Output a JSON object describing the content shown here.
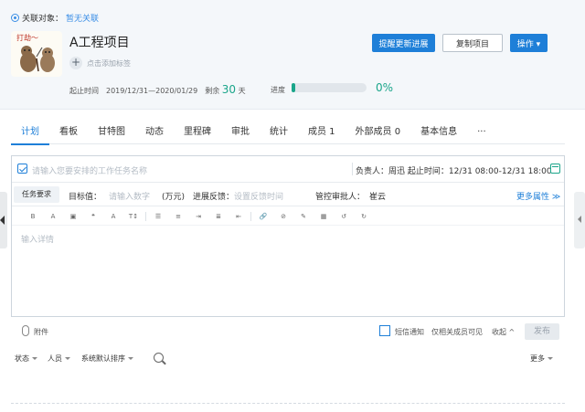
{
  "header": {
    "assoc_label": "关联对象：",
    "assoc_value": "暂无关联",
    "avatar_text": "打劫～",
    "title": "A工程项目",
    "add_tag": "点击添加标签",
    "buttons": {
      "remind": "提醒更新进展",
      "copy": "复制项目",
      "actions": "操作 ▾"
    },
    "meta": {
      "period_label": "起止时间",
      "period_value": "2019/12/31—2020/01/29",
      "remain_label": "剩余",
      "remain_num": "30",
      "remain_unit": "天",
      "progress_label": "进度",
      "progress_value": "0%",
      "progress_fraction": 0
    }
  },
  "tabs": [
    {
      "label": "计划"
    },
    {
      "label": "看板"
    },
    {
      "label": "甘特图"
    },
    {
      "label": "动态"
    },
    {
      "label": "里程碑"
    },
    {
      "label": "审批"
    },
    {
      "label": "统计"
    },
    {
      "label": "成员 1"
    },
    {
      "label": "外部成员 0"
    },
    {
      "label": "基本信息"
    },
    {
      "label": "···"
    }
  ],
  "editor": {
    "task_placeholder": "请输入您要安排的工作任务名称",
    "owner": "负责人：周迅",
    "time": "起止时间：12/31 08:00-12/31 18:00",
    "req_label": "任务要求",
    "target_label": "目标值：",
    "target_placeholder": "请输入数字",
    "target_unit": "(万元)",
    "feedback_label": "进展反馈：",
    "feedback_placeholder": "设置反馈时间",
    "approver_label": "管控审批人：",
    "approver_value": "崔云",
    "more_attrs": "更多属性 ≫",
    "detail_placeholder": "输入详情",
    "toolbar_icons": [
      "bold-icon",
      "italic-icon",
      "image-icon",
      "quote-icon",
      "font-size-icon",
      "font-style-icon",
      "bullet-list-icon",
      "numbered-list-icon",
      "indent-icon",
      "align-icon",
      "outdent-icon",
      "link-icon",
      "unlink-icon",
      "brush-icon",
      "table-icon",
      "undo-icon",
      "redo-icon"
    ]
  },
  "footer": {
    "attach": "附件",
    "sms": "短信通知",
    "visible": "仅相关成员可见",
    "collapse": "收起 ^",
    "publish": "发布"
  },
  "filters": {
    "status": "状态",
    "people": "人员",
    "sort": "系统默认排序",
    "more": "更多"
  }
}
